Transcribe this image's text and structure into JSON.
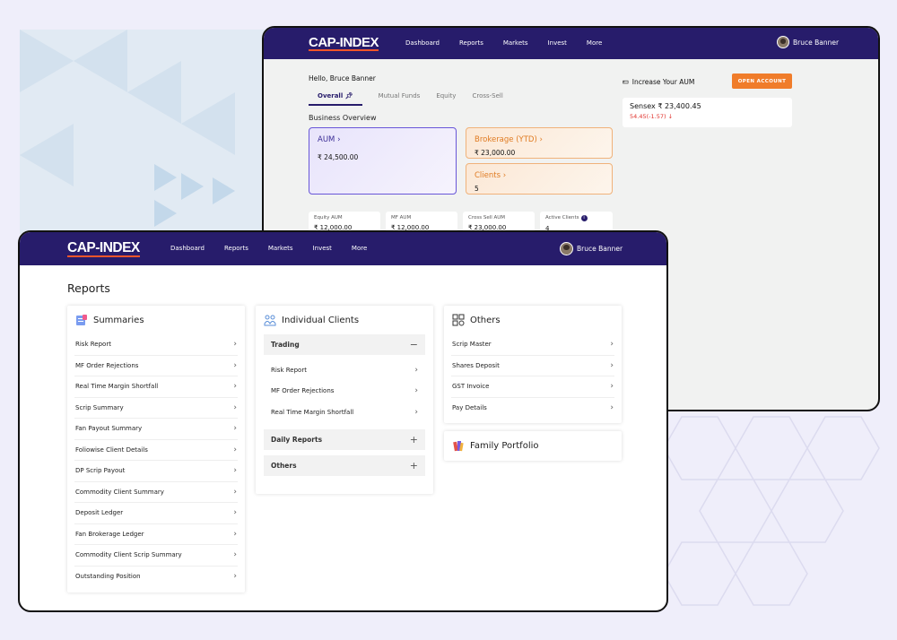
{
  "colors": {
    "brand_nav": "#271c6b",
    "accent_orange": "#f07c2a",
    "logo_underline": "#f0552a",
    "aum_card_border": "#6856d8",
    "negative": "#e0332d"
  },
  "back_window": {
    "logo": "CAP-INDEX",
    "nav_items": [
      "Dashboard",
      "Reports",
      "Markets",
      "Invest",
      "More"
    ],
    "user_name": "Bruce Banner",
    "greeting": "Hello, Bruce Banner",
    "tabs": [
      "Overall",
      "Mutual Funds",
      "Equity",
      "Cross-Sell"
    ],
    "section_title": "Business Overview",
    "aum_card": {
      "label": "AUM",
      "value": "₹ 24,500.00"
    },
    "brokerage_card": {
      "label": "Brokerage (YTD)",
      "value": "₹ 23,000.00"
    },
    "clients_card": {
      "label": "Clients",
      "value": "5"
    },
    "small_cards": [
      {
        "label": "Equity AUM",
        "value": "₹ 12,000.00"
      },
      {
        "label": "MF AUM",
        "value": "₹ 12,000.00"
      },
      {
        "label": "Cross Sell AUM",
        "value": "₹ 23,000.00"
      },
      {
        "label": "Active Clients",
        "value": "4"
      }
    ],
    "increase_aum": "Increase Your AUM",
    "open_account": "OPEN ACCOUNT",
    "sensex": {
      "label": "Sensex",
      "value": "₹ 23,400.45",
      "change": "54.45(-1.57)"
    }
  },
  "front_window": {
    "logo": "CAP-INDEX",
    "nav_items": [
      "Dashboard",
      "Reports",
      "Markets",
      "Invest",
      "More"
    ],
    "user_name": "Bruce Banner",
    "page_title": "Reports",
    "summaries": {
      "title": "Summaries",
      "items": [
        "Risk Report",
        "MF Order Rejections",
        "Real Time Margin Shortfall",
        "Scrip Summary",
        "Fan Payout Summary",
        "Foliowise Client Details",
        "DP Scrip Payout",
        "Commodity Client Summary",
        "Deposit Ledger",
        "Fan Brokerage Ledger",
        "Commodity Client Scrip Summary",
        "Outstanding Position"
      ]
    },
    "individual_clients": {
      "title": "Individual Clients",
      "trading": {
        "label": "Trading",
        "items": [
          "Risk Report",
          "MF Order Rejections",
          "Real Time Margin Shortfall"
        ]
      },
      "daily_reports": "Daily Reports",
      "others": "Others"
    },
    "others": {
      "title": "Others",
      "items": [
        "Scrip Master",
        "Shares Deposit",
        "GST Invoice",
        "Pay Details"
      ]
    },
    "family_portfolio": {
      "title": "Family Portfolio"
    }
  }
}
